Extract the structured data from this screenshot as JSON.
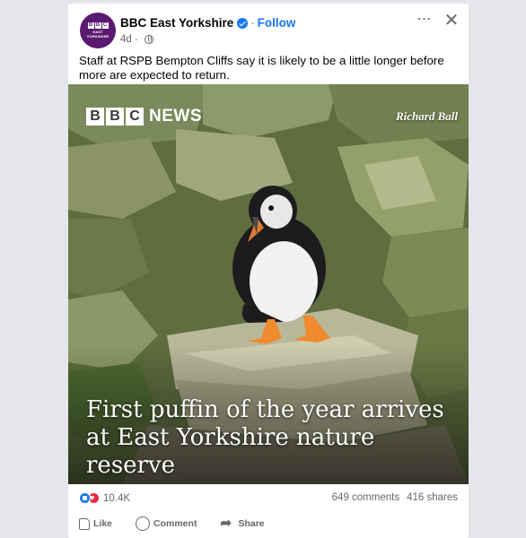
{
  "post": {
    "page_name": "BBC East Yorkshire",
    "follow_label": "Follow",
    "age": "4d",
    "caption": "Staff at RSPB Bempton Cliffs say it is likely to be a little longer before more are expected to return.",
    "avatar": {
      "blocks": [
        "B",
        "B",
        "C"
      ],
      "line1": "EAST",
      "line2": "YORKSHIRE"
    },
    "more_icon": "⋯",
    "close_icon": "✕"
  },
  "media": {
    "logo_blocks": [
      "B",
      "B",
      "C"
    ],
    "logo_word": "NEWS",
    "credit": "Richard Ball",
    "headline": "First puffin of the year arrives at East Yorkshire nature reserve"
  },
  "stats": {
    "reactions_count": "10.4K",
    "comments": "649 comments",
    "shares": "416 shares"
  },
  "actions": {
    "like": "Like",
    "comment": "Comment",
    "share": "Share"
  },
  "colors": {
    "accent": "#1877f2",
    "avatar_bg": "#5a1a70",
    "love": "#f02849",
    "muted_text": "#65676b"
  }
}
